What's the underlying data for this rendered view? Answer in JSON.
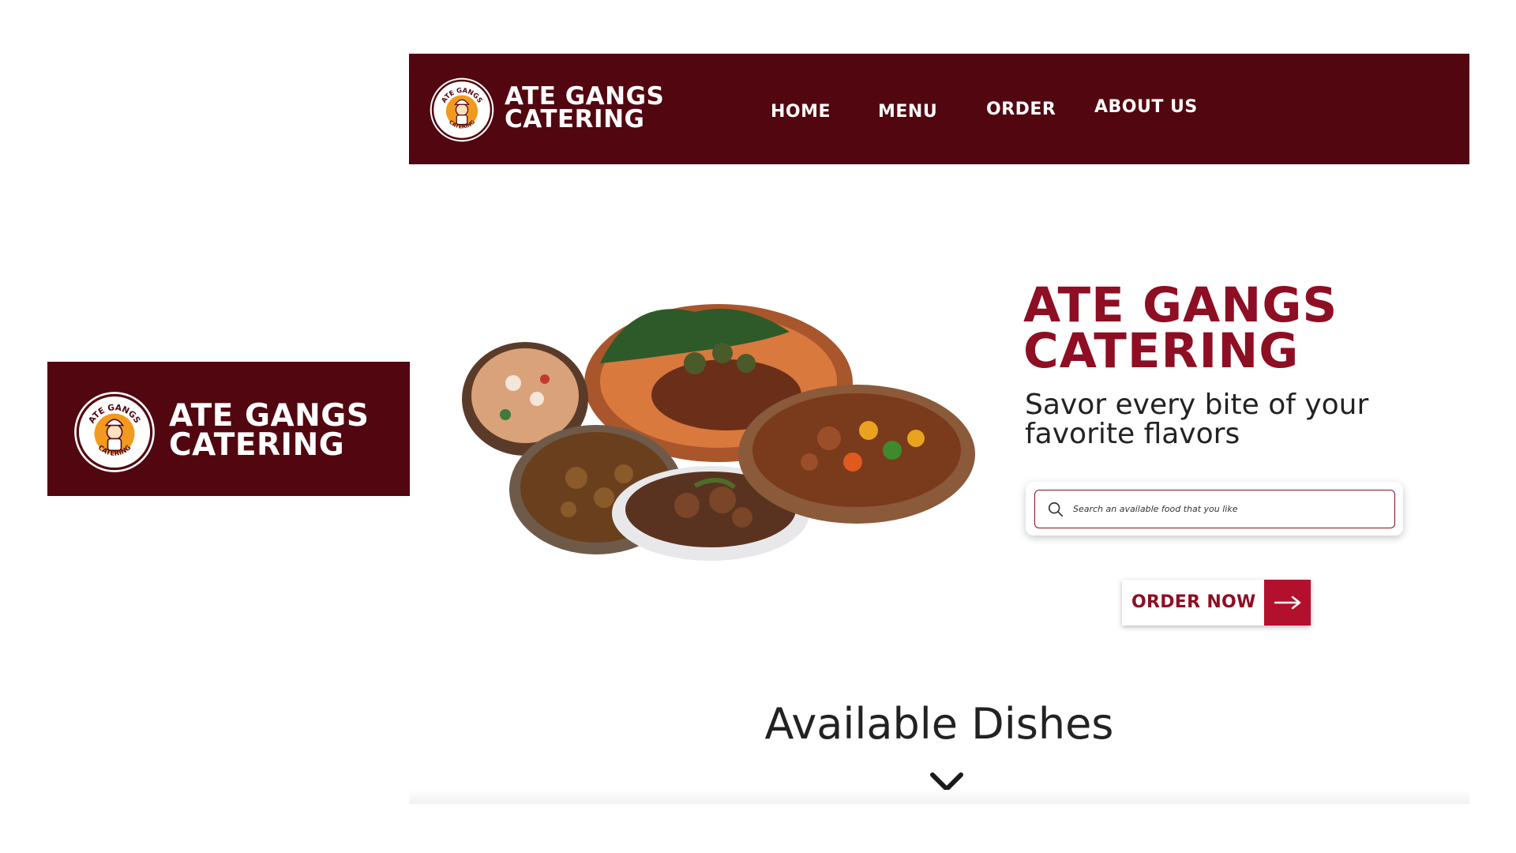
{
  "colors": {
    "maroon": "#520610",
    "accent_red": "#8e0e23",
    "button_red": "#b3102e",
    "badge_orange": "#f29a1f"
  },
  "brand": {
    "line1": "ATE GANGS",
    "line2": "CATERING"
  },
  "logo_badge": {
    "top_text": "ATE GANGS",
    "bottom_text": "CATERING",
    "icon": "chef-mascot-icon"
  },
  "nav": {
    "items": [
      {
        "label": "HOME"
      },
      {
        "label": "MENU"
      },
      {
        "label": "ORDER"
      },
      {
        "label": "ABOUT US"
      }
    ]
  },
  "hero": {
    "title_line1": "ATE GANGS",
    "title_line2": "CATERING",
    "subtitle_line1": "Savor every bite of your",
    "subtitle_line2": "favorite flavors",
    "image_icon": "food-dishes-image"
  },
  "search": {
    "placeholder": "Search an available food that you like",
    "value": "",
    "icon": "search-icon"
  },
  "order_button": {
    "label": "ORDER NOW",
    "icon": "arrow-right-icon"
  },
  "dishes": {
    "title": "Available Dishes",
    "icon": "chevron-down-icon"
  }
}
